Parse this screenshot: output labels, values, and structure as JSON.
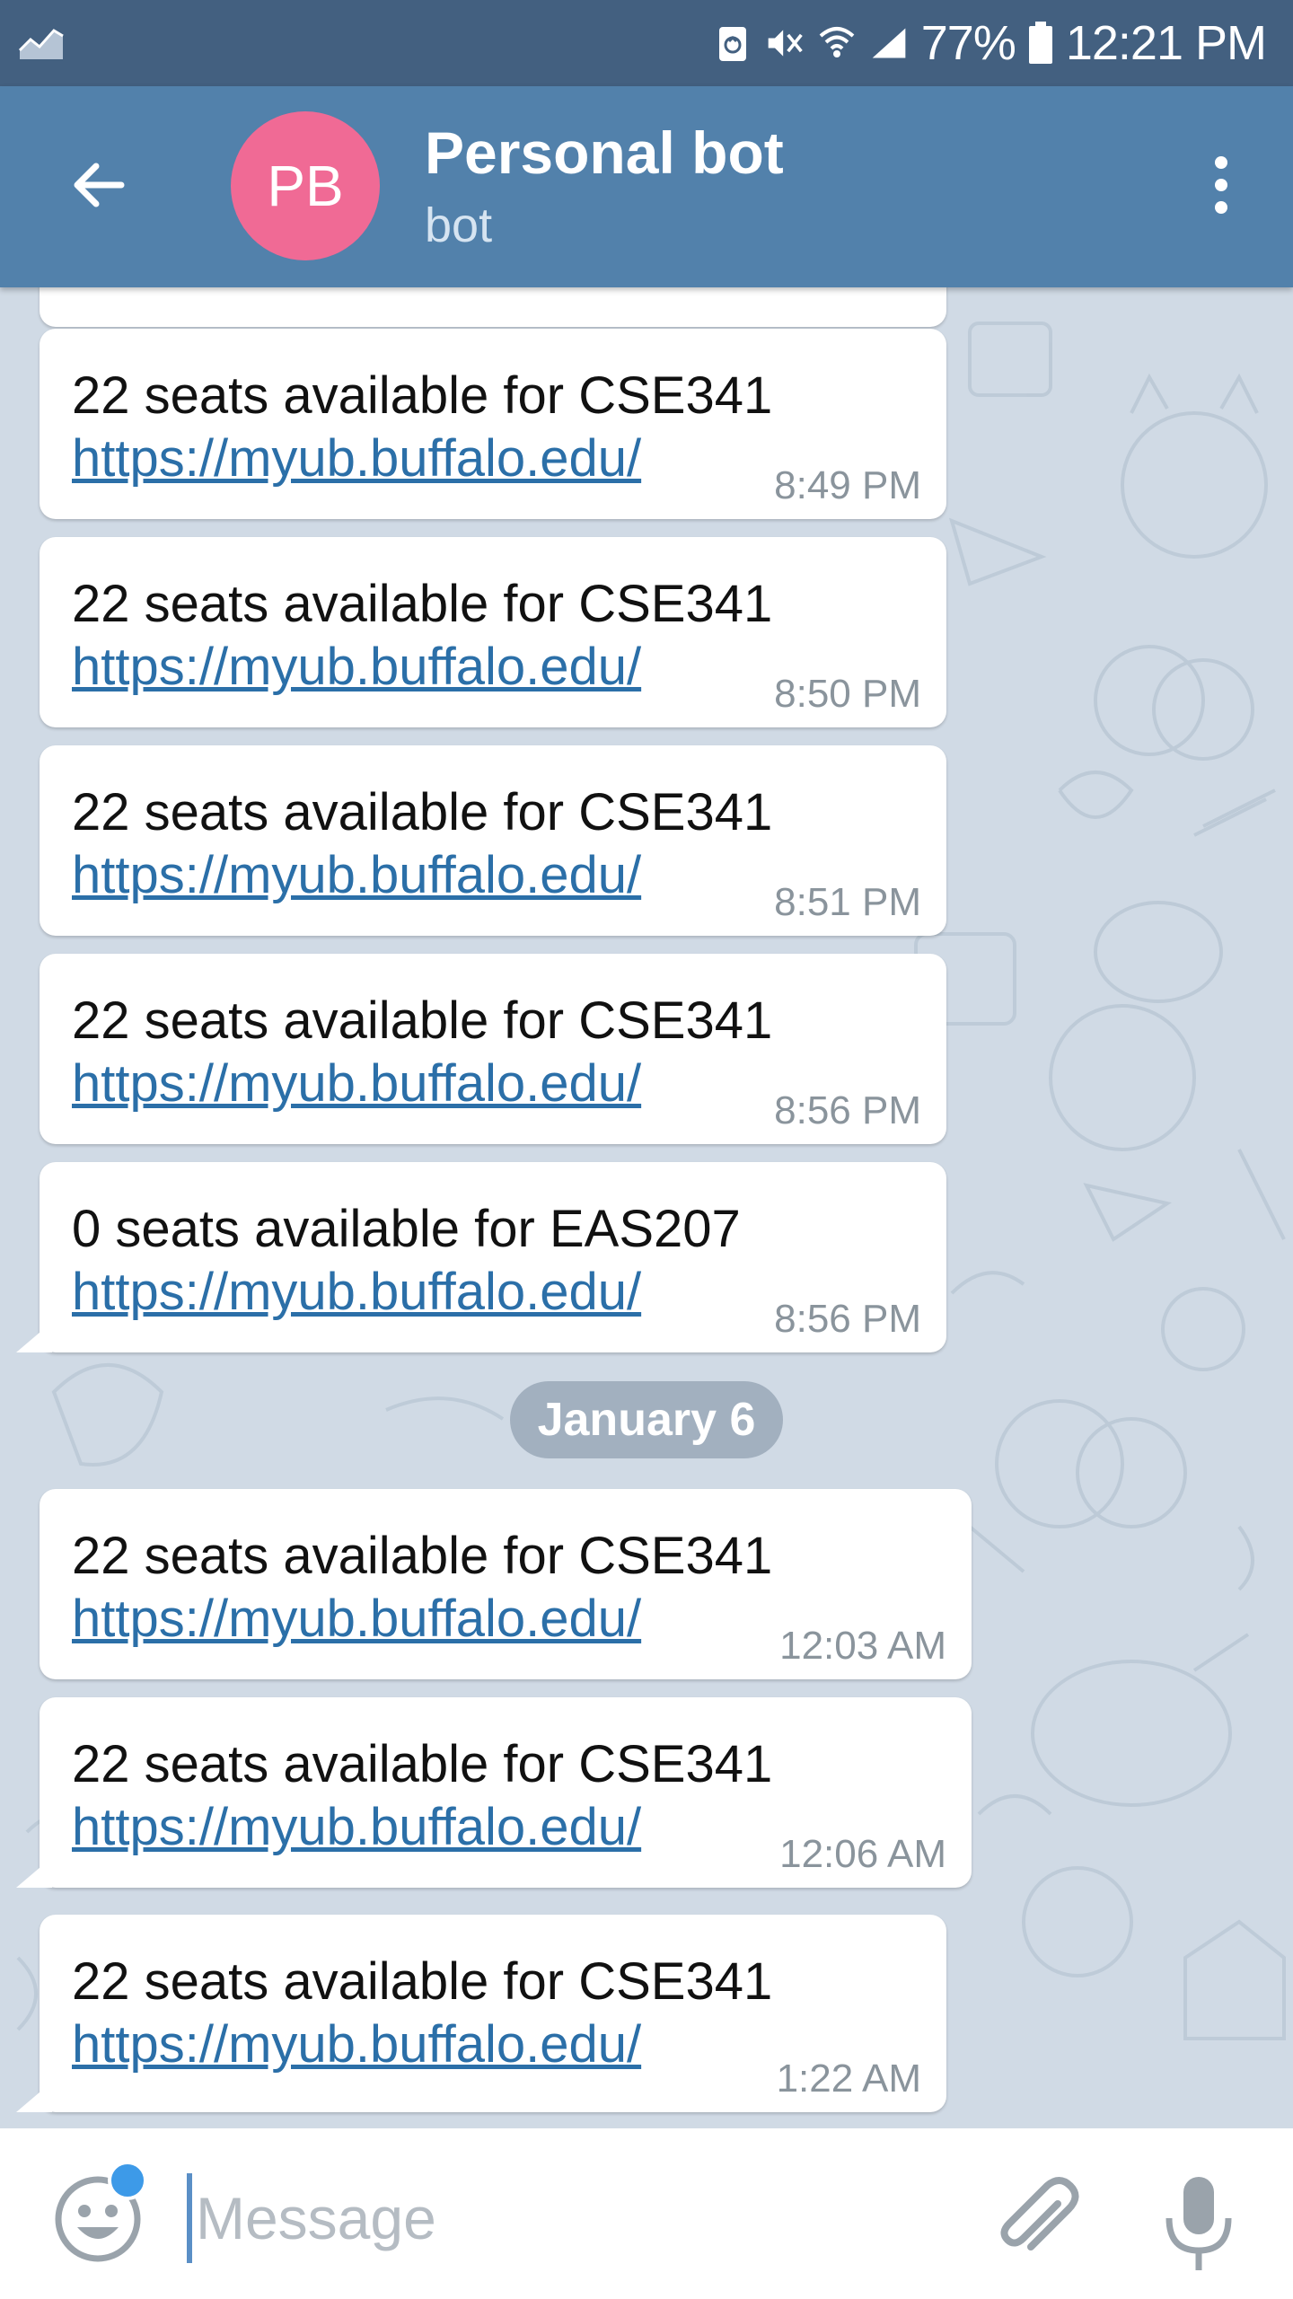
{
  "status_bar": {
    "battery_percent": "77%",
    "time": "12:21 PM",
    "icons": [
      "activity-icon",
      "recycle-icon",
      "vibrate-off-icon",
      "wifi-icon",
      "signal-icon",
      "battery-icon"
    ]
  },
  "app_bar": {
    "avatar_initials": "PB",
    "avatar_color": "#f06a95",
    "title": "Personal bot",
    "subtitle": "bot",
    "bar_color": "#5281ab"
  },
  "messages_group1": [
    {
      "text": "22 seats available for CSE341",
      "link": "https://myub.buffalo.edu/",
      "time": "8:49 PM"
    },
    {
      "text": "22 seats available for CSE341",
      "link": "https://myub.buffalo.edu/",
      "time": "8:50 PM"
    },
    {
      "text": "22 seats available for CSE341",
      "link": "https://myub.buffalo.edu/",
      "time": "8:51 PM"
    },
    {
      "text": "22 seats available for CSE341",
      "link": "https://myub.buffalo.edu/",
      "time": "8:56 PM"
    },
    {
      "text": "0 seats available for EAS207",
      "link": "https://myub.buffalo.edu/",
      "time": "8:56 PM"
    }
  ],
  "date_separator": "January 6",
  "messages_group2": [
    {
      "text": "22 seats available for CSE341",
      "link": "https://myub.buffalo.edu/",
      "time": "12:03 AM"
    },
    {
      "text": "22 seats available for CSE341",
      "link": "https://myub.buffalo.edu/",
      "time": "12:06 AM"
    },
    {
      "text": "22 seats available for CSE341",
      "link": "https://myub.buffalo.edu/",
      "time": "1:22 AM"
    }
  ],
  "input": {
    "placeholder": "Message",
    "value": ""
  }
}
